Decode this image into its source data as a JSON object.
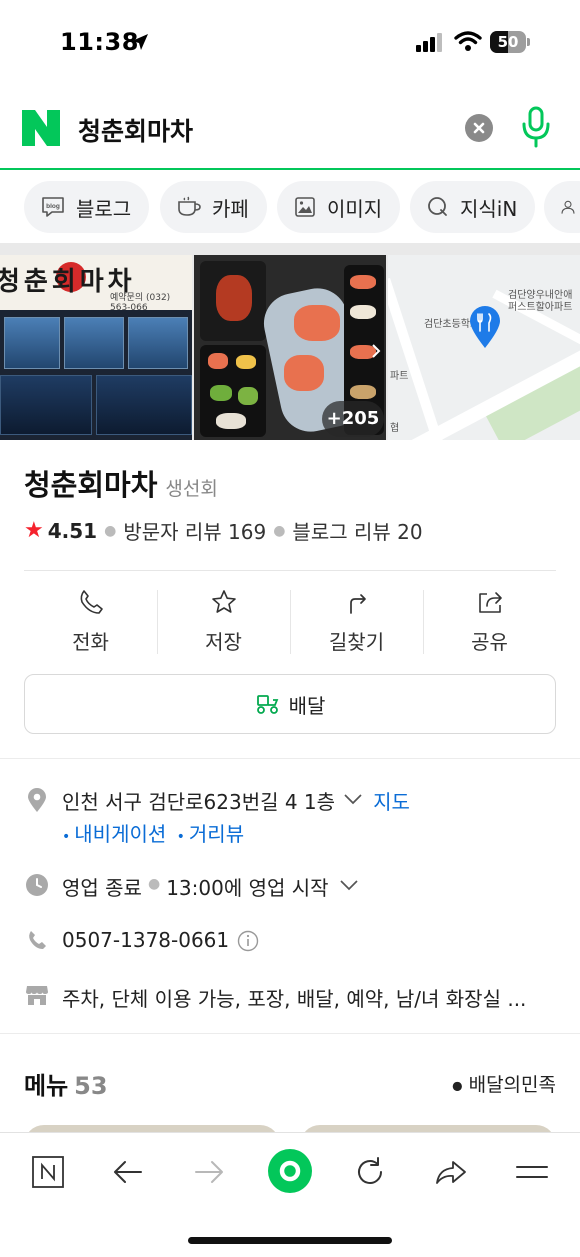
{
  "status_bar": {
    "time": "11:38",
    "battery_level": 50,
    "battery_text": "50"
  },
  "search": {
    "logo_letter": "N",
    "query": "청춘회마차",
    "brand_color": "#03c75a"
  },
  "chips": [
    {
      "icon": "blog-icon",
      "label": "블로그"
    },
    {
      "icon": "cafe-cup-icon",
      "label": "카페"
    },
    {
      "icon": "image-icon",
      "label": "이미지"
    },
    {
      "icon": "knowledge-q-icon",
      "label": "지식iN"
    }
  ],
  "photos": {
    "more_count": "+205",
    "storefront_sign": "청춘회마차",
    "storefront_phone": "예약문의 (032) 563-066",
    "map_labels": [
      "검단초등학교",
      "검단양우내안애\n퍼스트할아파트",
      "파트",
      "협"
    ]
  },
  "place": {
    "name": "청춘회마차",
    "category": "생선회",
    "rating": "4.51",
    "visitor_reviews": "방문자 리뷰 169",
    "blog_reviews": "블로그 리뷰 20"
  },
  "actions": [
    {
      "icon": "phone-icon",
      "label": "전화"
    },
    {
      "icon": "star-icon",
      "label": "저장"
    },
    {
      "icon": "directions-icon",
      "label": "길찾기"
    },
    {
      "icon": "share-icon",
      "label": "공유"
    }
  ],
  "delivery_label": "배달",
  "info": {
    "address": "인천 서구 검단로623번길 4 1층",
    "map_link": "지도",
    "navigation_link": "내비게이션",
    "street_view_link": "거리뷰",
    "hours_status": "영업 종료",
    "hours_detail": "13:00에 영업 시작",
    "phone": "0507-1378-0661",
    "amenities": "주차, 단체 이용 가능, 포장, 배달, 예약, 남/녀 화장실 ..."
  },
  "menu": {
    "title": "메뉴",
    "count": "53",
    "source": "배달의민족"
  },
  "colors": {
    "accent": "#03c75a",
    "link": "#0a6cd6",
    "star": "#f5222d"
  }
}
